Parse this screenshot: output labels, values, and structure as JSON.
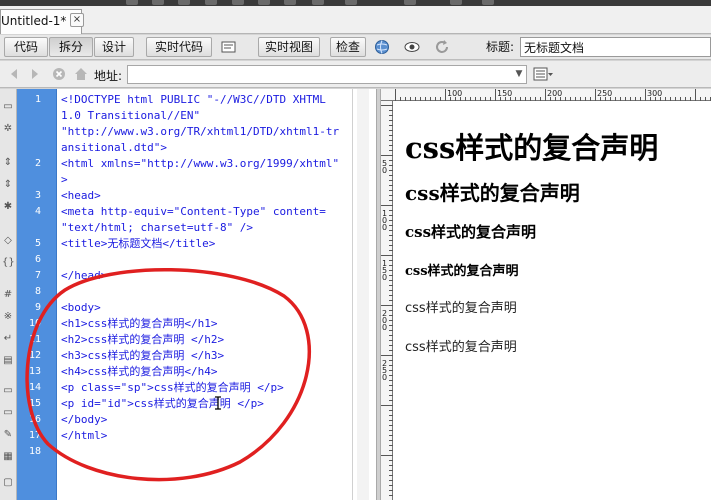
{
  "doc_tab": {
    "label": "Untitled-1*",
    "close": "×"
  },
  "view_toolbar": {
    "code": "代码",
    "split": "拆分",
    "design": "设计",
    "live_code": "实时代码",
    "live_view": "实时视图",
    "inspect": "检查",
    "title_label": "标题:",
    "title_value": "无标题文档"
  },
  "address_bar": {
    "label": "地址:",
    "value": ""
  },
  "code": {
    "line_numbers": [
      {
        "n": "1",
        "row": 0
      },
      {
        "n": "2",
        "row": 4
      },
      {
        "n": "3",
        "row": 6
      },
      {
        "n": "4",
        "row": 7
      },
      {
        "n": "5",
        "row": 9
      },
      {
        "n": "6",
        "row": 10
      },
      {
        "n": "7",
        "row": 11
      },
      {
        "n": "8",
        "row": 12
      },
      {
        "n": "9",
        "row": 13
      },
      {
        "n": "10",
        "row": 14
      },
      {
        "n": "11",
        "row": 15
      },
      {
        "n": "12",
        "row": 16
      },
      {
        "n": "13",
        "row": 17
      },
      {
        "n": "14",
        "row": 18
      },
      {
        "n": "15",
        "row": 19
      },
      {
        "n": "16",
        "row": 20
      },
      {
        "n": "17",
        "row": 21
      },
      {
        "n": "18",
        "row": 22
      }
    ],
    "lines": [
      "<!DOCTYPE html PUBLIC \"-//W3C//DTD XHTML",
      "1.0 Transitional//EN\"",
      "\"http://www.w3.org/TR/xhtml1/DTD/xhtml1-tr",
      "ansitional.dtd\">",
      "<html xmlns=\"http://www.w3.org/1999/xhtml\"",
      ">",
      "<head>",
      "<meta http-equiv=\"Content-Type\" content=",
      "\"text/html; charset=utf-8\" />",
      "<title>无标题文档</title>",
      "",
      "</head>",
      "",
      "<body>",
      "<h1>css样式的复合声明</h1>",
      "<h2>css样式的复合声明 </h2>",
      "<h3>css样式的复合声明 </h3>",
      "<h4>css样式的复合声明</h4>",
      "<p class=\"sp\">css样式的复合声明 </p>",
      "<p id=\"id\">css样式的复合声明 </p>",
      "</body>",
      "</html>",
      ""
    ]
  },
  "ruler": {
    "labels": [
      "100",
      "150",
      "200",
      "250",
      "300"
    ],
    "vlabels": [
      "50",
      "100",
      "150",
      "200",
      "250"
    ]
  },
  "design_view": {
    "h1": "css样式的复合声明",
    "h2": "css样式的复合声明",
    "h3": "css样式的复合声明",
    "h4": "css样式的复合声明",
    "p_sp": "css样式的复合声明",
    "p_id": "css样式的复合声明"
  },
  "colors": {
    "gutter": "#4f8fde",
    "annotation": "#e02020",
    "code_text": "#1a1ae0"
  }
}
